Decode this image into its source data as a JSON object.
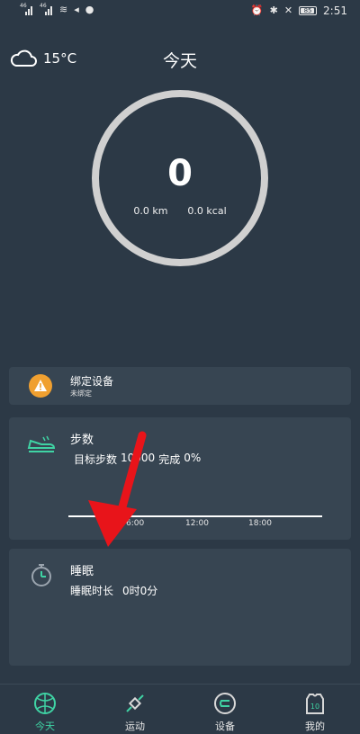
{
  "status_bar": {
    "clock": "2:51",
    "battery": "85",
    "signal_labels": [
      "46",
      "46"
    ]
  },
  "header": {
    "temperature": "15°C",
    "title": "今天"
  },
  "summary": {
    "steps": "0",
    "distance": "0.0 km",
    "calories": "0.0 kcal"
  },
  "bind_card": {
    "title": "绑定设备",
    "subtitle": "未绑定"
  },
  "steps_card": {
    "title": "步数",
    "goal_label": "目标步数",
    "goal_value": "10000",
    "done_label": "完成",
    "done_value": "0%",
    "ticks": [
      "6:00",
      "12:00",
      "18:00"
    ]
  },
  "sleep_card": {
    "title": "睡眠",
    "duration_label": "睡眠时长",
    "duration_value": "0时0分"
  },
  "nav": {
    "items": [
      {
        "label": "今天",
        "icon": "basketball-icon",
        "active": true
      },
      {
        "label": "运动",
        "icon": "satellite-icon",
        "active": false
      },
      {
        "label": "设备",
        "icon": "watch-icon",
        "active": false
      },
      {
        "label": "我的",
        "icon": "jersey-icon",
        "active": false
      }
    ],
    "jersey_number": "10"
  },
  "colors": {
    "background": "#2c3946",
    "card": "#374552",
    "accent": "#3fd3a4",
    "warning": "#f0a030",
    "ring": "#d0d0d0",
    "annotation": "#e8141a"
  }
}
